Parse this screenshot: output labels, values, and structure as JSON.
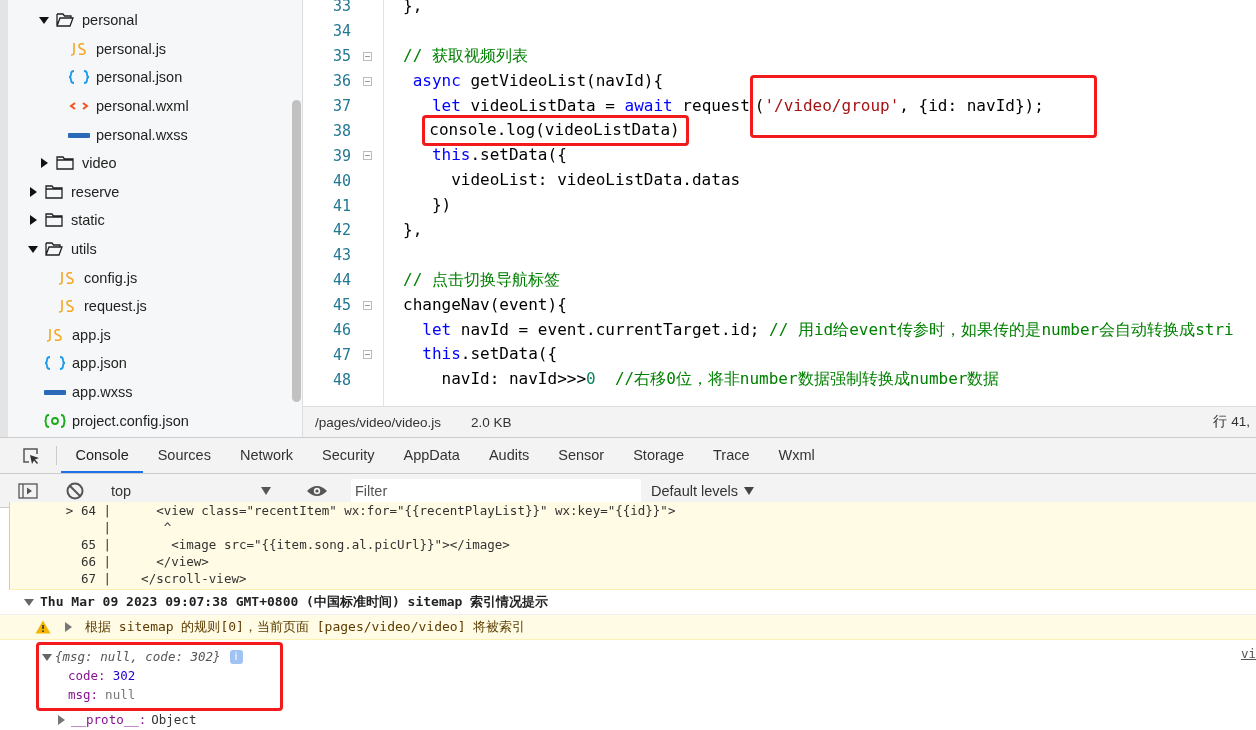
{
  "file_tree": [
    {
      "kind": "group",
      "children": [
        {
          "kind": "folder",
          "name": "personal",
          "expanded": true,
          "children": [
            {
              "name": "personal.js",
              "kind": "js"
            },
            {
              "name": "personal.json",
              "kind": "json"
            },
            {
              "name": "personal.wxml",
              "kind": "wxml"
            },
            {
              "name": "personal.wxss",
              "kind": "wxss"
            }
          ]
        },
        {
          "kind": "folder",
          "name": "video",
          "expanded": false
        }
      ]
    },
    {
      "kind": "folder",
      "name": "reserve",
      "expanded": false
    },
    {
      "kind": "folder",
      "name": "static",
      "expanded": false
    },
    {
      "kind": "folder",
      "name": "utils",
      "expanded": true,
      "children": [
        {
          "name": "config.js",
          "kind": "js"
        },
        {
          "name": "request.js",
          "kind": "js"
        }
      ]
    },
    {
      "name": "app.js",
      "kind": "js"
    },
    {
      "name": "app.json",
      "kind": "json"
    },
    {
      "name": "app.wxss",
      "kind": "wxss"
    },
    {
      "name": "project.config.json",
      "kind": "config"
    }
  ],
  "editor": {
    "lines": [
      {
        "number": "33",
        "tokens": [
          {
            "t": "},",
            "kind": "plain"
          }
        ]
      },
      {
        "number": "34"
      },
      {
        "number": "35",
        "fold": true,
        "tokens": [
          {
            "t": "// 获取视频列表",
            "kind": "comment"
          }
        ]
      },
      {
        "number": "36",
        "fold": true,
        "tokens": [
          {
            "t": " async",
            "kind": "keyword"
          },
          {
            "t": " getVideoList(navId){",
            "kind": "plain"
          }
        ]
      },
      {
        "number": "37",
        "tokens": [
          {
            "t": "   let",
            "kind": "keyword"
          },
          {
            "t": " videoListData = ",
            "kind": "plain"
          },
          {
            "t": "await",
            "kind": "keyword"
          },
          {
            "t": " request",
            "kind": "plain"
          },
          {
            "kind": "group",
            "boxed": true,
            "tokens": [
              {
                "t": "(",
                "kind": "plain"
              },
              {
                "t": "'/video/group'",
                "kind": "string"
              },
              {
                "t": ", {id: navId});",
                "kind": "plain"
              }
            ]
          }
        ]
      },
      {
        "number": "38",
        "tokens": [
          {
            "kind": "group",
            "boxed": true,
            "tokens": [
              {
                "t": "console.log(videoListData)",
                "kind": "plain"
              }
            ]
          }
        ]
      },
      {
        "number": "39",
        "fold": true,
        "tokens": [
          {
            "t": "   this",
            "kind": "keyword"
          },
          {
            "t": ".setData({",
            "kind": "plain"
          }
        ]
      },
      {
        "number": "40",
        "tokens": [
          {
            "t": "     videoList: videoListData.datas",
            "kind": "plain"
          }
        ]
      },
      {
        "number": "41",
        "tokens": [
          {
            "t": "   })",
            "kind": "plain"
          }
        ]
      },
      {
        "number": "42",
        "tokens": [
          {
            "t": "},",
            "kind": "plain"
          }
        ]
      },
      {
        "number": "43"
      },
      {
        "number": "44",
        "tokens": [
          {
            "t": "// 点击切换导航标签",
            "kind": "comment"
          }
        ]
      },
      {
        "number": "45",
        "fold": true,
        "tokens": [
          {
            "t": "changeNav(event){",
            "kind": "plain"
          }
        ]
      },
      {
        "number": "46",
        "tokens": [
          {
            "t": "  let",
            "kind": "keyword"
          },
          {
            "t": " navId = event.currentTarget.id; ",
            "kind": "plain"
          },
          {
            "t": "// 用id给event传参时，如果传的是number会自动转换成stri",
            "kind": "comment"
          }
        ]
      },
      {
        "number": "47",
        "fold": true,
        "tokens": [
          {
            "t": "  this",
            "kind": "keyword"
          },
          {
            "t": ".setData({",
            "kind": "plain"
          }
        ]
      },
      {
        "number": "48",
        "tokens": [
          {
            "t": "    navId: navId>>>",
            "kind": "plain"
          },
          {
            "t": "0",
            "kind": "number"
          },
          {
            "t": "  //右移0位，将非number数据强制转换成number数据",
            "kind": "comment"
          }
        ]
      }
    ]
  },
  "status_bar": {
    "path": "/pages/video/video.js",
    "size": "2.0 KB",
    "position": "行 41,"
  },
  "devtools": {
    "tabs": [
      {
        "label": "Console",
        "selected": true
      },
      {
        "label": "Sources",
        "selected": false
      },
      {
        "label": "Network",
        "selected": false
      },
      {
        "label": "Security",
        "selected": false
      },
      {
        "label": "AppData",
        "selected": false
      },
      {
        "label": "Audits",
        "selected": false
      },
      {
        "label": "Sensor",
        "selected": false
      },
      {
        "label": "Storage",
        "selected": false
      },
      {
        "label": "Trace",
        "selected": false
      },
      {
        "label": "Wxml",
        "selected": false
      }
    ],
    "context": "top",
    "filter": {
      "placeholder": "Filter"
    },
    "levels": "Default levels"
  },
  "console": {
    "code_frame": [
      {
        "gutter": "> 64 |",
        "code": "      <view class=\"recentItem\" wx:for=\"{{recentPlayList}}\" wx:key=\"{{id}}\">"
      },
      {
        "gutter": "   |",
        "code": "       ^"
      },
      {
        "gutter": "65 |",
        "code": "        <image src=\"{{item.song.al.picUrl}}\"></image>"
      },
      {
        "gutter": "66 |",
        "code": "      </view>"
      },
      {
        "gutter": "67 |",
        "code": "    </scroll-view>"
      }
    ],
    "group": {
      "title": "Thu Mar 09 2023 09:07:38 GMT+0800 (中国标准时间) sitemap 索引情况提示",
      "expanded": true
    },
    "warning": {
      "text": "根据 sitemap 的规则[0]，当前页面 [pages/video/video] 将被索引",
      "expanded": false
    },
    "object": {
      "summary": "{msg: null, code: 302}",
      "expanded": true,
      "boxed": true,
      "source": "vi",
      "info": "i",
      "props": [
        {
          "key": "code:",
          "value": "302",
          "kind": "number"
        },
        {
          "key": "msg:",
          "value": "null",
          "kind": "null"
        }
      ],
      "proto": {
        "key": "__proto__:",
        "value": "Object",
        "expanded": false
      }
    }
  }
}
